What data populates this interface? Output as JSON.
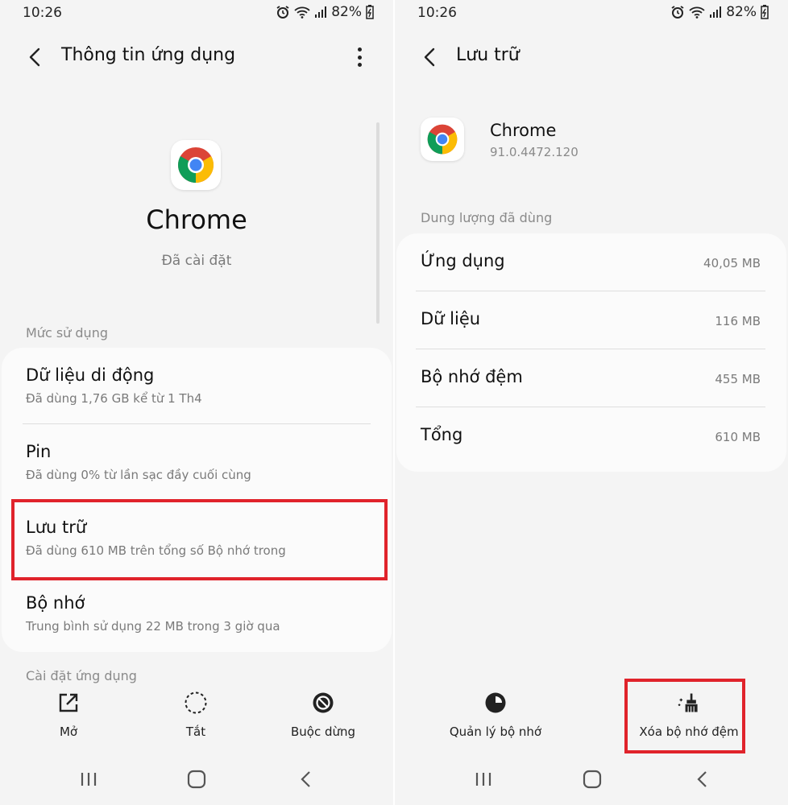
{
  "status_bar": {
    "time": "10:26",
    "battery": "82%"
  },
  "left": {
    "header": {
      "title": "Thông tin ứng dụng"
    },
    "app": {
      "name": "Chrome",
      "status": "Đã cài đặt"
    },
    "usage_section": {
      "label": "Mức sử dụng",
      "items": [
        {
          "title": "Dữ liệu di động",
          "subtitle": "Đã dùng 1,76 GB kể từ 1 Th4"
        },
        {
          "title": "Pin",
          "subtitle": "Đã dùng 0% từ lần sạc đầy cuối cùng"
        },
        {
          "title": "Lưu trữ",
          "subtitle": "Đã dùng 610 MB trên tổng số Bộ nhớ trong"
        },
        {
          "title": "Bộ nhớ",
          "subtitle": "Trung bình sử dụng 22 MB trong 3 giờ qua"
        }
      ]
    },
    "settings_section": {
      "label": "Cài đặt ứng dụng"
    },
    "actions": [
      {
        "label": "Mở",
        "icon": "open-external-icon"
      },
      {
        "label": "Tắt",
        "icon": "disable-dashed-circle-icon"
      },
      {
        "label": "Buộc dừng",
        "icon": "force-stop-icon"
      }
    ]
  },
  "right": {
    "header": {
      "title": "Lưu trữ"
    },
    "app": {
      "name": "Chrome",
      "version": "91.0.4472.120"
    },
    "storage_section": {
      "label": "Dung lượng đã dùng",
      "items": [
        {
          "title": "Ứng dụng",
          "value": "40,05 MB"
        },
        {
          "title": "Dữ liệu",
          "value": "116 MB"
        },
        {
          "title": "Bộ nhớ đệm",
          "value": "455 MB"
        },
        {
          "title": "Tổng",
          "value": "610 MB"
        }
      ]
    },
    "actions": [
      {
        "label": "Quản lý bộ nhớ",
        "icon": "storage-pie-icon"
      },
      {
        "label": "Xóa bộ nhớ đệm",
        "icon": "clear-cache-broom-icon"
      }
    ]
  },
  "colors": {
    "highlight": "#e0232b",
    "background": "#f4f4f4",
    "card": "#fbfbfb"
  }
}
